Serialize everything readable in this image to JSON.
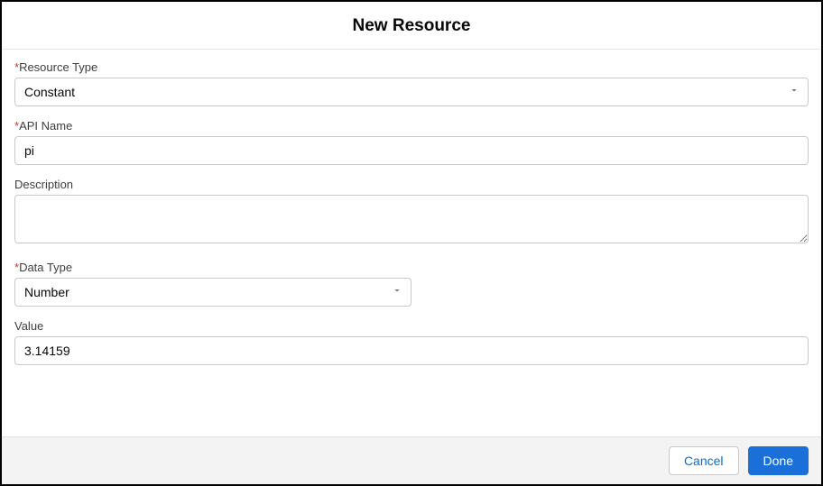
{
  "header": {
    "title": "New Resource"
  },
  "fields": {
    "resource_type": {
      "label": "Resource Type",
      "required": true,
      "value": "Constant"
    },
    "api_name": {
      "label": "API Name",
      "required": true,
      "value": "pi"
    },
    "description": {
      "label": "Description",
      "required": false,
      "value": ""
    },
    "data_type": {
      "label": "Data Type",
      "required": true,
      "value": "Number"
    },
    "value": {
      "label": "Value",
      "required": false,
      "value": "3.14159"
    }
  },
  "footer": {
    "cancel": "Cancel",
    "done": "Done"
  }
}
